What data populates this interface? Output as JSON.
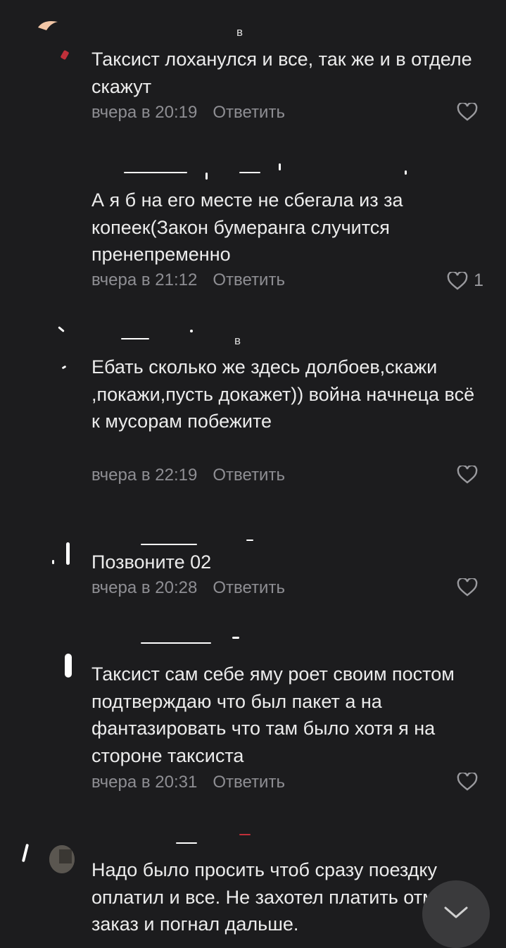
{
  "comments": [
    {
      "author": "в",
      "text": "Таксист лоханулся и все, так же и в отделе скажут",
      "time": "вчера в 20:19",
      "reply": "Ответить",
      "likes": ""
    },
    {
      "author": "",
      "text": "А я б на его месте не сбегала из за копеек(Закон бумеранга случится пренепременно",
      "time": "вчера в 21:12",
      "reply": "Ответить",
      "likes": "1"
    },
    {
      "author": "в",
      "text": "Ебать сколько же здесь долбоев,скажи ,покажи,пусть докажет)) война начнеца всё к мусорам побежите",
      "time": "вчера в 22:19",
      "reply": "Ответить",
      "likes": ""
    },
    {
      "author": "",
      "text": "Позвоните 02",
      "time": "вчера в 20:28",
      "reply": "Ответить",
      "likes": ""
    },
    {
      "author": "",
      "text": "Таксист сам себе яму роет своим постом подтверждаю что был пакет а на фантазировать что там было хотя я на стороне таксиста",
      "time": "вчера в 20:31",
      "reply": "Ответить",
      "likes": ""
    },
    {
      "author": "",
      "text": "Надо было просить чтоб сразу поездку оплатил и все. Не захотел платить отменил заказ и погнал дальше.",
      "time": "",
      "reply": "",
      "likes": ""
    }
  ],
  "icons": {
    "like": "heart-outline-icon",
    "scroll": "chevron-down-icon"
  },
  "colors": {
    "background": "#1c1c1e",
    "text": "#ececec",
    "meta": "#8e8e93",
    "button": "#3a3a3c"
  }
}
